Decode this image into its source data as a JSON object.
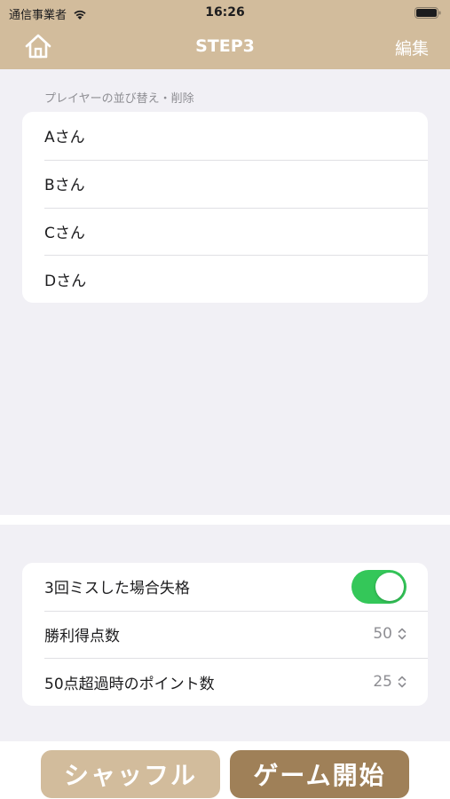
{
  "status_bar": {
    "carrier": "通信事業者",
    "time": "16:26"
  },
  "nav": {
    "title": "STEP3",
    "edit_label": "編集",
    "home_icon": "home-icon"
  },
  "players_section": {
    "header": "プレイヤーの並び替え・削除",
    "players": [
      "Aさん",
      "Bさん",
      "Cさん",
      "Dさん"
    ]
  },
  "settings": {
    "disqualify": {
      "label": "3回ミスした場合失格",
      "enabled": true
    },
    "winning_score": {
      "label": "勝利得点数",
      "value": "50"
    },
    "overflow_points": {
      "label": "50点超過時のポイント数",
      "value": "25"
    }
  },
  "actions": {
    "shuffle_label": "シャッフル",
    "start_label": "ゲーム開始"
  },
  "colors": {
    "header": "#d2bc9c",
    "shuffle_button": "#d2bc9c",
    "start_button": "#9f8058",
    "toggle_on": "#34c759"
  }
}
